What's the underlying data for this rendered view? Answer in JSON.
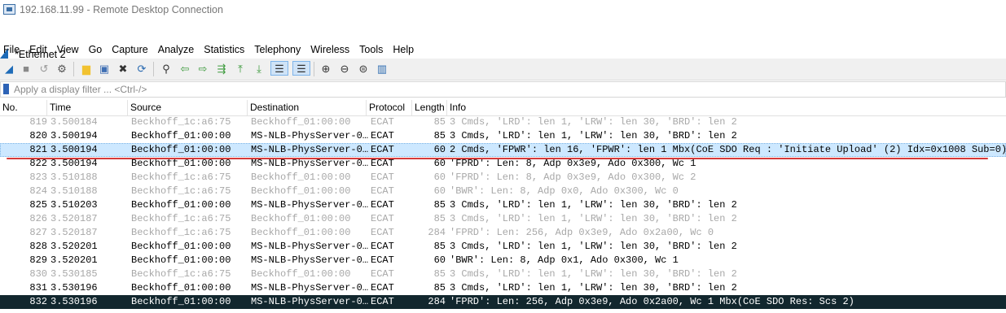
{
  "rdp": {
    "title": "192.168.11.99 - Remote Desktop Connection"
  },
  "app": {
    "title": "*Ethernet 2"
  },
  "menu": [
    "File",
    "Edit",
    "View",
    "Go",
    "Capture",
    "Analyze",
    "Statistics",
    "Telephony",
    "Wireless",
    "Tools",
    "Help"
  ],
  "toolbar": {
    "items": [
      {
        "name": "start-capture-icon",
        "glyph": "◢",
        "color": "#1e6bb8"
      },
      {
        "name": "stop-capture-icon",
        "glyph": "■",
        "color": "#8a8a8a"
      },
      {
        "name": "restart-capture-icon",
        "glyph": "↺",
        "color": "#9a9a9a"
      },
      {
        "name": "capture-options-icon",
        "glyph": "⚙",
        "color": "#555555"
      },
      {
        "name": "open-file-icon",
        "glyph": "▆",
        "color": "#f2c230"
      },
      {
        "name": "save-file-icon",
        "glyph": "▣",
        "color": "#3f6fb3"
      },
      {
        "name": "close-file-icon",
        "glyph": "✖",
        "color": "#333333"
      },
      {
        "name": "reload-file-icon",
        "glyph": "⟳",
        "color": "#2a6ab0"
      },
      {
        "name": "find-packet-icon",
        "glyph": "⚲",
        "color": "#333333"
      },
      {
        "name": "go-back-icon",
        "glyph": "⇦",
        "color": "#3c9a3c"
      },
      {
        "name": "go-forward-icon",
        "glyph": "⇨",
        "color": "#3c9a3c"
      },
      {
        "name": "go-to-packet-icon",
        "glyph": "⇶",
        "color": "#3c9a3c"
      },
      {
        "name": "first-packet-icon",
        "glyph": "⤒",
        "color": "#3c9a3c"
      },
      {
        "name": "last-packet-icon",
        "glyph": "⤓",
        "color": "#3c9a3c"
      },
      {
        "name": "autoscroll-icon",
        "glyph": "☰",
        "color": "#333333"
      },
      {
        "name": "colorize-icon",
        "glyph": "☰",
        "color": "#333333"
      },
      {
        "name": "zoom-in-icon",
        "glyph": "⊕",
        "color": "#333333"
      },
      {
        "name": "zoom-out-icon",
        "glyph": "⊖",
        "color": "#333333"
      },
      {
        "name": "normal-size-icon",
        "glyph": "⊜",
        "color": "#333333"
      },
      {
        "name": "resize-columns-icon",
        "glyph": "▥",
        "color": "#2a6ab0"
      }
    ]
  },
  "filter": {
    "placeholder": "Apply a display filter ... <Ctrl-/>"
  },
  "columns": [
    "No.",
    "Time",
    "Source",
    "Destination",
    "Protocol",
    "Length",
    "Info"
  ],
  "packets": [
    {
      "no": "819",
      "time": "3.500184",
      "src": "Beckhoff_1c:a6:75",
      "dst": "Beckhoff_01:00:00",
      "proto": "ECAT",
      "len": "85",
      "info": "3 Cmds, 'LRD': len 1, 'LRW': len 30, 'BRD': len 2",
      "style": "grey"
    },
    {
      "no": "820",
      "time": "3.500194",
      "src": "Beckhoff_01:00:00",
      "dst": "MS-NLB-PhysServer-0…",
      "proto": "ECAT",
      "len": "85",
      "info": "3 Cmds, 'LRD': len 1, 'LRW': len 30, 'BRD': len 2",
      "style": "normal"
    },
    {
      "no": "821",
      "time": "3.500194",
      "src": "Beckhoff_01:00:00",
      "dst": "MS-NLB-PhysServer-0…",
      "proto": "ECAT",
      "len": "60",
      "info": "2 Cmds, 'FPWR': len 16, 'FPWR': len 1  Mbx(CoE SDO Req : 'Initiate Upload' (2) Idx=0x1008 Sub=0)",
      "style": "sel"
    },
    {
      "no": "822",
      "time": "3.500194",
      "src": "Beckhoff_01:00:00",
      "dst": "MS-NLB-PhysServer-0…",
      "proto": "ECAT",
      "len": "60",
      "info": "'FPRD': Len: 8, Adp 0x3e9, Ado 0x300, Wc 1",
      "style": "normal"
    },
    {
      "no": "823",
      "time": "3.510188",
      "src": "Beckhoff_1c:a6:75",
      "dst": "Beckhoff_01:00:00",
      "proto": "ECAT",
      "len": "60",
      "info": "'FPRD': Len: 8, Adp 0x3e9, Ado 0x300, Wc 2",
      "style": "grey"
    },
    {
      "no": "824",
      "time": "3.510188",
      "src": "Beckhoff_1c:a6:75",
      "dst": "Beckhoff_01:00:00",
      "proto": "ECAT",
      "len": "60",
      "info": "'BWR': Len: 8, Adp 0x0, Ado 0x300, Wc 0",
      "style": "grey"
    },
    {
      "no": "825",
      "time": "3.510203",
      "src": "Beckhoff_01:00:00",
      "dst": "MS-NLB-PhysServer-0…",
      "proto": "ECAT",
      "len": "85",
      "info": "3 Cmds, 'LRD': len 1, 'LRW': len 30, 'BRD': len 2",
      "style": "normal"
    },
    {
      "no": "826",
      "time": "3.520187",
      "src": "Beckhoff_1c:a6:75",
      "dst": "Beckhoff_01:00:00",
      "proto": "ECAT",
      "len": "85",
      "info": "3 Cmds, 'LRD': len 1, 'LRW': len 30, 'BRD': len 2",
      "style": "grey"
    },
    {
      "no": "827",
      "time": "3.520187",
      "src": "Beckhoff_1c:a6:75",
      "dst": "Beckhoff_01:00:00",
      "proto": "ECAT",
      "len": "284",
      "info": "'FPRD': Len: 256, Adp 0x3e9, Ado 0x2a00, Wc 0",
      "style": "grey"
    },
    {
      "no": "828",
      "time": "3.520201",
      "src": "Beckhoff_01:00:00",
      "dst": "MS-NLB-PhysServer-0…",
      "proto": "ECAT",
      "len": "85",
      "info": "3 Cmds, 'LRD': len 1, 'LRW': len 30, 'BRD': len 2",
      "style": "normal"
    },
    {
      "no": "829",
      "time": "3.520201",
      "src": "Beckhoff_01:00:00",
      "dst": "MS-NLB-PhysServer-0…",
      "proto": "ECAT",
      "len": "60",
      "info": "'BWR': Len: 8, Adp 0x1, Ado 0x300, Wc 1",
      "style": "normal"
    },
    {
      "no": "830",
      "time": "3.530185",
      "src": "Beckhoff_1c:a6:75",
      "dst": "Beckhoff_01:00:00",
      "proto": "ECAT",
      "len": "85",
      "info": "3 Cmds, 'LRD': len 1, 'LRW': len 30, 'BRD': len 2",
      "style": "grey"
    },
    {
      "no": "831",
      "time": "3.530196",
      "src": "Beckhoff_01:00:00",
      "dst": "MS-NLB-PhysServer-0…",
      "proto": "ECAT",
      "len": "85",
      "info": "3 Cmds, 'LRD': len 1, 'LRW': len 30, 'BRD': len 2",
      "style": "normal"
    },
    {
      "no": "832",
      "time": "3.530196",
      "src": "Beckhoff_01:00:00",
      "dst": "MS-NLB-PhysServer-0…",
      "proto": "ECAT",
      "len": "284",
      "info": "'FPRD': Len: 256, Adp 0x3e9, Ado 0x2a00, Wc 1  Mbx(CoE SDO Res: Scs 2)",
      "style": "dark"
    }
  ],
  "colors": {
    "selected_row": "#cde8ff",
    "dark_row": "#12272e",
    "grey_text": "#a8a8a8",
    "annotation": "#d53a3a"
  }
}
